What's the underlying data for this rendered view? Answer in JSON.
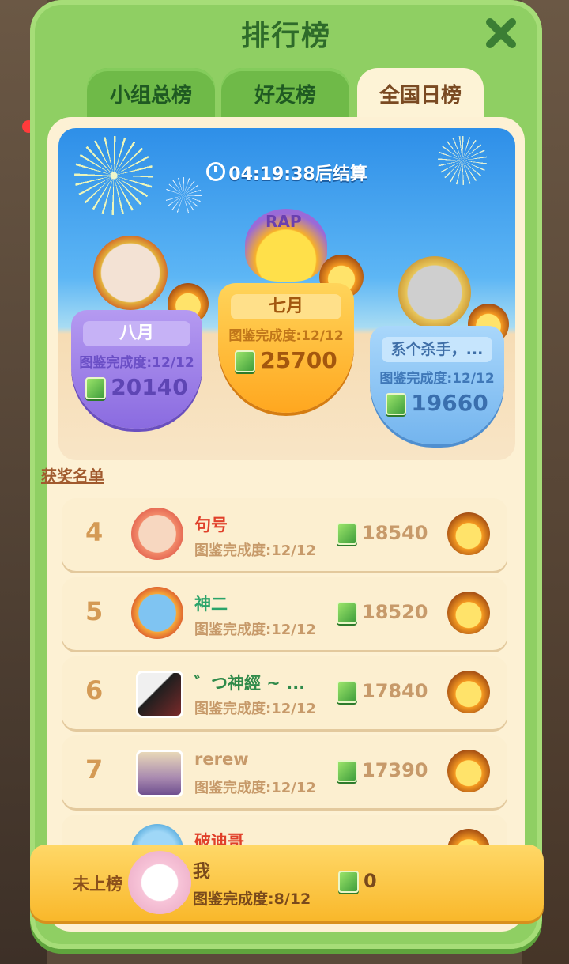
{
  "title": "排行榜",
  "tabs": [
    {
      "label": "小组总榜",
      "active": false
    },
    {
      "label": "好友榜",
      "active": false
    },
    {
      "label": "全国日榜",
      "active": true
    }
  ],
  "timer_text": "04:19:38后结算",
  "podium": [
    {
      "place": 2,
      "name": "八月",
      "completion": "图鉴完成度:12/12",
      "score": "20140"
    },
    {
      "place": 1,
      "name": "七月",
      "completion": "图鉴完成度:12/12",
      "score": "25700",
      "badge_text": "RAP"
    },
    {
      "place": 3,
      "name": "系个杀手，...",
      "completion": "图鉴完成度:12/12",
      "score": "19660"
    }
  ],
  "awards_title": "获奖名单",
  "list": [
    {
      "rank": "4",
      "name": "句号",
      "completion": "图鉴完成度:12/12",
      "score": "18540",
      "name_color": "#e0402a"
    },
    {
      "rank": "5",
      "name": "神二",
      "completion": "图鉴完成度:12/12",
      "score": "18520",
      "name_color": "#2aa46a"
    },
    {
      "rank": "6",
      "name": "゛つ神經 ~ ...",
      "completion": "图鉴完成度:12/12",
      "score": "17840",
      "name_color": "#2f8a4a"
    },
    {
      "rank": "7",
      "name": "rerew",
      "completion": "图鉴完成度:12/12",
      "score": "17390",
      "name_color": "#c79a6a"
    },
    {
      "rank": "",
      "name": "破迪哥",
      "completion": "",
      "score": "",
      "name_color": "#e0402a"
    }
  ],
  "mine": {
    "status": "未上榜",
    "name": "我",
    "completion": "图鉴完成度:8/12",
    "score": "0"
  },
  "colors": {
    "panel": "#8fcf63",
    "tab_active": "#fdf3d6",
    "silver_shield": "#9b7ee6",
    "gold_shield": "#ffb020",
    "bronze_shield": "#79b8ee"
  }
}
